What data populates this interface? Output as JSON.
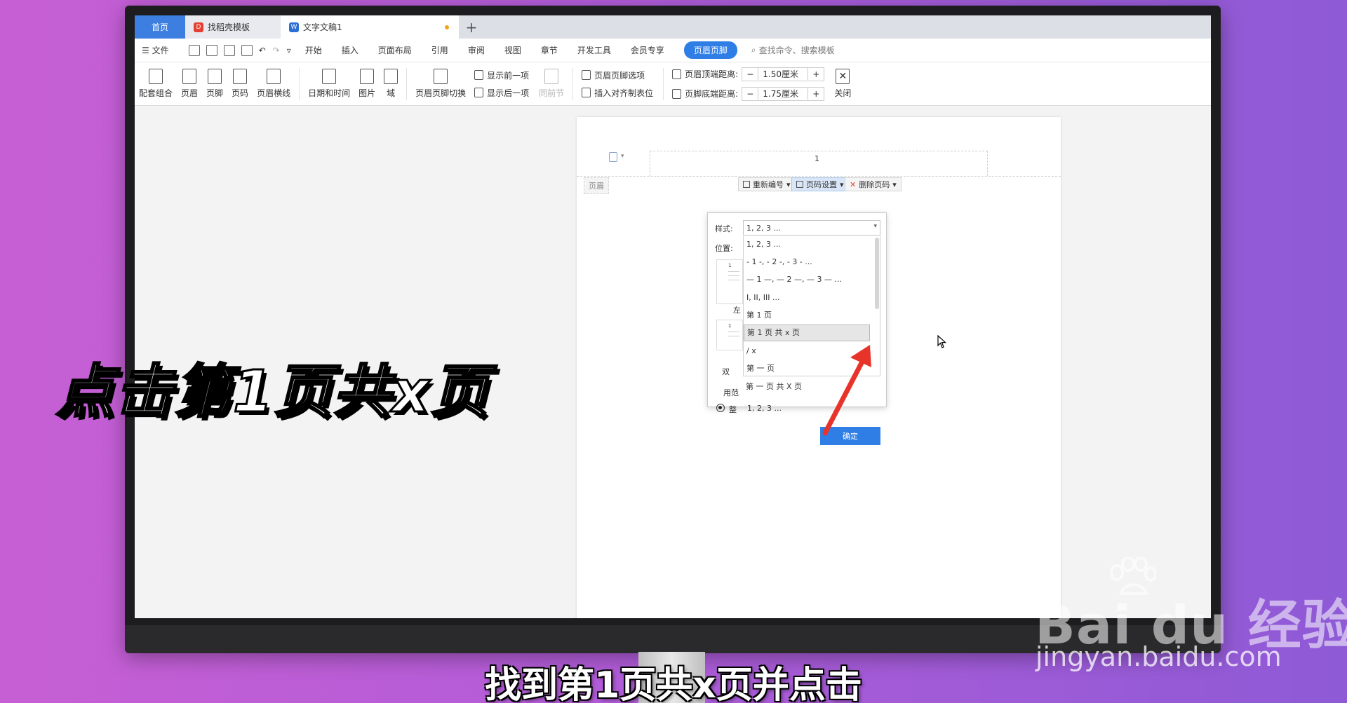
{
  "tabs": [
    {
      "label": "首页"
    },
    {
      "label": "找稻壳模板"
    },
    {
      "label": "文字文稿1"
    }
  ],
  "menu": {
    "file": "文件",
    "items": [
      "开始",
      "插入",
      "页面布局",
      "引用",
      "审阅",
      "视图",
      "章节",
      "开发工具",
      "会员专享"
    ],
    "active": "页眉页脚",
    "search": "查找命令、搜索模板"
  },
  "toolbar": {
    "combo": "配套组合",
    "header": "页眉",
    "footer": "页脚",
    "pagenum": "页码",
    "header_line": "页眉横线",
    "datetime": "日期和时间",
    "picture": "图片",
    "field": "域",
    "switch": "页眉页脚切换",
    "show_prev": "显示前一项",
    "show_next": "显示后一项",
    "same_as_prev": "同前节",
    "hf_options": "页眉页脚选项",
    "insert_tab": "插入对齐制表位",
    "top_dist_label": "页眉顶端距离:",
    "top_dist_value": "1.50厘米",
    "bottom_dist_label": "页脚底端距离:",
    "bottom_dist_value": "1.75厘米",
    "minus": "−",
    "plus": "+",
    "close": "关闭"
  },
  "document": {
    "page_number": "1",
    "header_tag": "页眉",
    "renumber": "重新编号",
    "pagenum_settings": "页码设置",
    "delete_pagenum": "删除页码"
  },
  "popup": {
    "style_label": "样式:",
    "style_value": "1, 2, 3 ...",
    "position_label": "位置:",
    "left_label": "左",
    "dual_label": "双",
    "apply_label": "用范",
    "whole_label": "整",
    "whole_value": "1, 2, 3 ...",
    "options": [
      "1, 2, 3 ...",
      "- 1 -, - 2 -, - 3 - ...",
      "— 1 —, — 2 —, — 3 — ...",
      "I, II, III ...",
      "第 1 页",
      "第 1 页 共 x 页",
      "/ x",
      "第 一 页",
      "第 一 页 共 X 页"
    ],
    "highlighted_index": 5,
    "ok": "确定"
  },
  "captions": {
    "left": "点击第1页共x页",
    "bottom": "找到第1页共x页并点击"
  },
  "watermark": {
    "logo": "Bai  du 经验",
    "url": "jingyan.baidu.com"
  },
  "colors": {
    "accent": "#2f7ee6",
    "arrow": "#e8332a"
  }
}
